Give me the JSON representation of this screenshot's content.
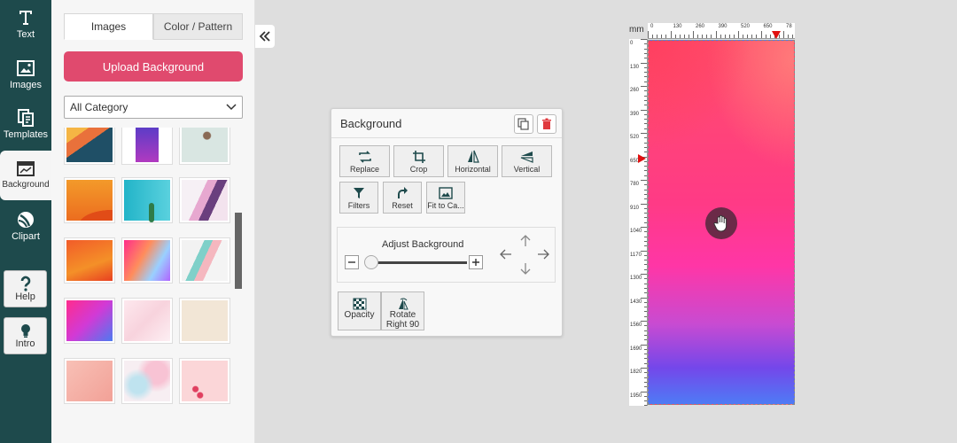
{
  "sidebar": {
    "tools": [
      {
        "label": "Text",
        "icon": "text-icon"
      },
      {
        "label": "Images",
        "icon": "image-icon"
      },
      {
        "label": "Templates",
        "icon": "templates-icon"
      },
      {
        "label": "Background",
        "icon": "background-icon",
        "active": true
      },
      {
        "label": "Clipart",
        "icon": "clipart-icon"
      }
    ],
    "help_label": "Help",
    "intro_label": "Intro"
  },
  "panel": {
    "tab_images": "Images",
    "tab_color_pattern": "Color / Pattern",
    "upload_label": "Upload Background",
    "category_selected": "All Category"
  },
  "dialog": {
    "title": "Background",
    "buttons_row1": [
      "Replace",
      "Crop",
      "Horizontal",
      "Vertical"
    ],
    "buttons_row2": [
      "Filters",
      "Reset",
      "Fit to Ca..."
    ],
    "adjust_title": "Adjust Background",
    "opacity_label": "Opacity",
    "rotate_label_1": "Rotate",
    "rotate_label_2": "Right 90"
  },
  "canvas": {
    "unit": "mm",
    "h_ticks": [
      "0",
      "130",
      "260",
      "390",
      "520",
      "650",
      "78"
    ],
    "v_ticks": [
      "0",
      "130",
      "260",
      "390",
      "520",
      "650",
      "780",
      "910",
      "1040",
      "1170",
      "1300",
      "1430",
      "1560",
      "1690",
      "1820",
      "1950"
    ]
  },
  "colors": {
    "sidebar_bg": "#1e4a4c",
    "accent": "#e04a6e"
  }
}
